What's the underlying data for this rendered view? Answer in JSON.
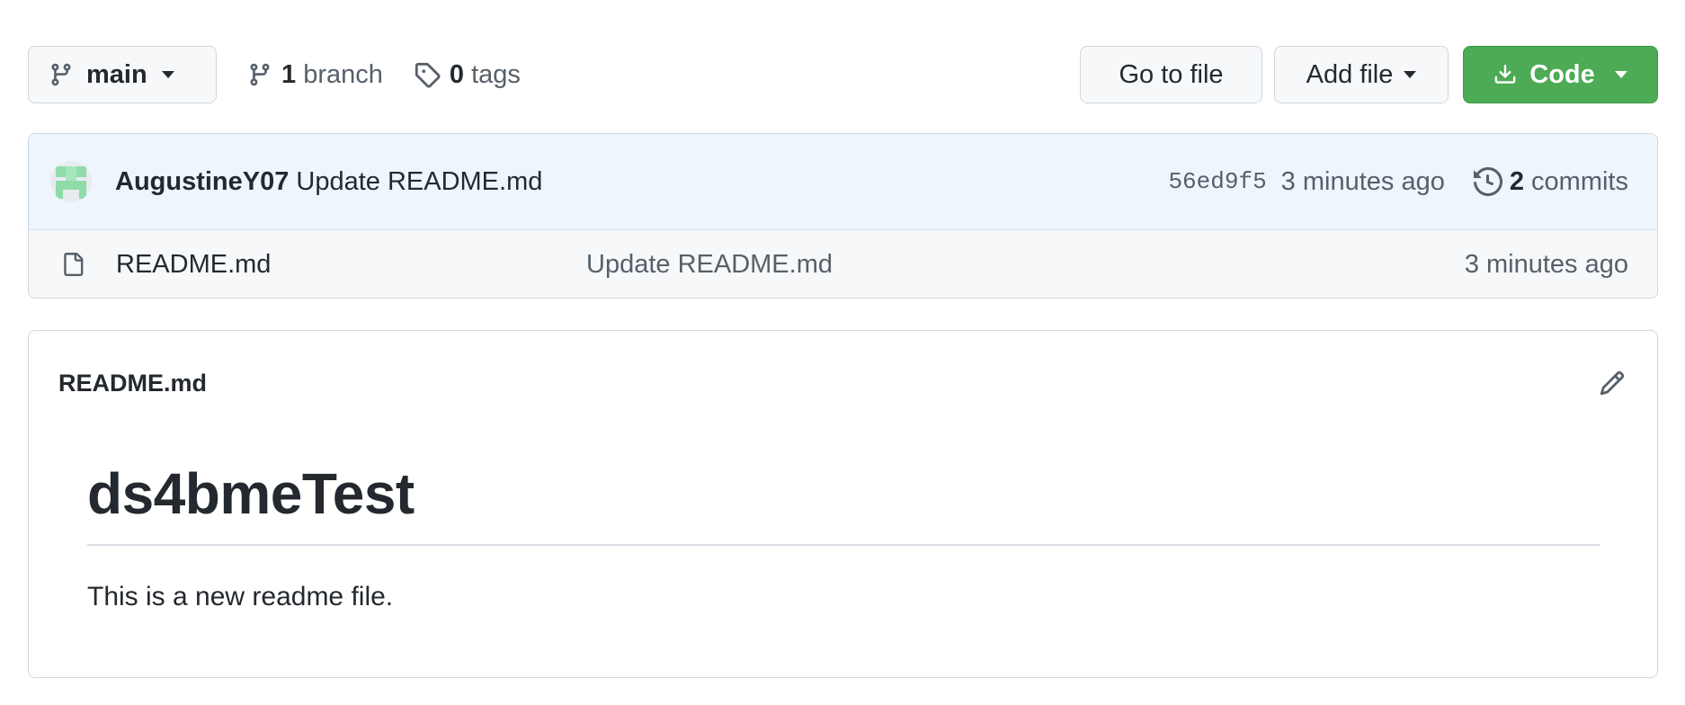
{
  "toolbar": {
    "branch_button": {
      "label": "main",
      "icon": "git-branch-icon"
    },
    "branches": {
      "count": "1",
      "label": "branch",
      "icon": "git-branch-icon"
    },
    "tags": {
      "count": "0",
      "label": "tags",
      "icon": "tag-icon"
    },
    "goto_file_label": "Go to file",
    "add_file_label": "Add file",
    "code_label": "Code",
    "code_color": "#4cab54"
  },
  "latest_commit": {
    "author": "AugustineY07",
    "message": "Update README.md",
    "hash": "56ed9f5",
    "time": "3 minutes ago",
    "commits_count": "2",
    "commits_label": "commits",
    "row_background": "#eef5fd"
  },
  "files": [
    {
      "icon": "file-icon",
      "name": "README.md",
      "commit_message": "Update README.md",
      "time": "3 minutes ago"
    }
  ],
  "readme": {
    "filename": "README.md",
    "heading": "ds4bmeTest",
    "paragraph": "This is a new readme file."
  }
}
